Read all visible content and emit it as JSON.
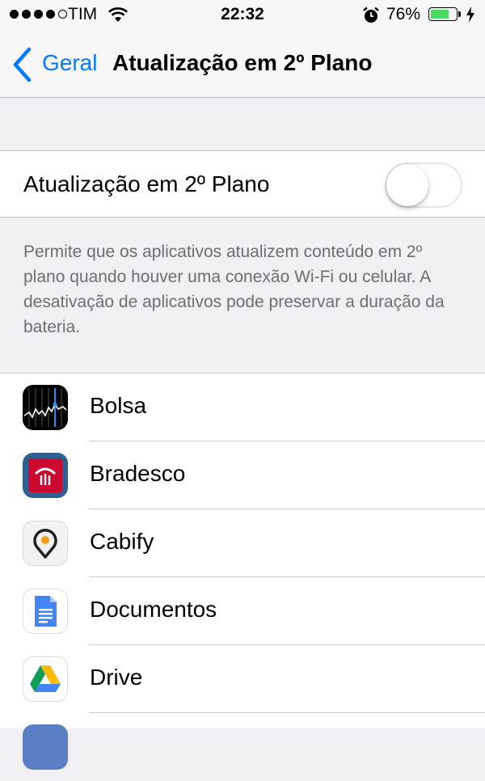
{
  "status_bar": {
    "signal_dots_filled": 4,
    "signal_dots_total": 5,
    "carrier": "TIM",
    "time": "22:32",
    "battery_percent": "76%",
    "battery_level": 0.76,
    "battery_color": "#4cd964",
    "icons": [
      "wifi-icon",
      "alarm-icon",
      "battery-icon",
      "charging-icon"
    ]
  },
  "nav": {
    "back_label": "Geral",
    "title": "Atualização em 2º Plano",
    "accent_color": "#007aff"
  },
  "setting": {
    "label": "Atualização em 2º Plano",
    "enabled": false,
    "description": "Permite que os aplicativos atualizem conteúdo em 2º plano quando houver uma conexão Wi-Fi ou celular. A desativação de aplicativos pode preservar a duração da bateria."
  },
  "apps": [
    {
      "name": "Bolsa",
      "icon": "stocks-icon"
    },
    {
      "name": "Bradesco",
      "icon": "bradesco-icon"
    },
    {
      "name": "Cabify",
      "icon": "cabify-icon"
    },
    {
      "name": "Documentos",
      "icon": "docs-icon"
    },
    {
      "name": "Drive",
      "icon": "drive-icon"
    }
  ]
}
